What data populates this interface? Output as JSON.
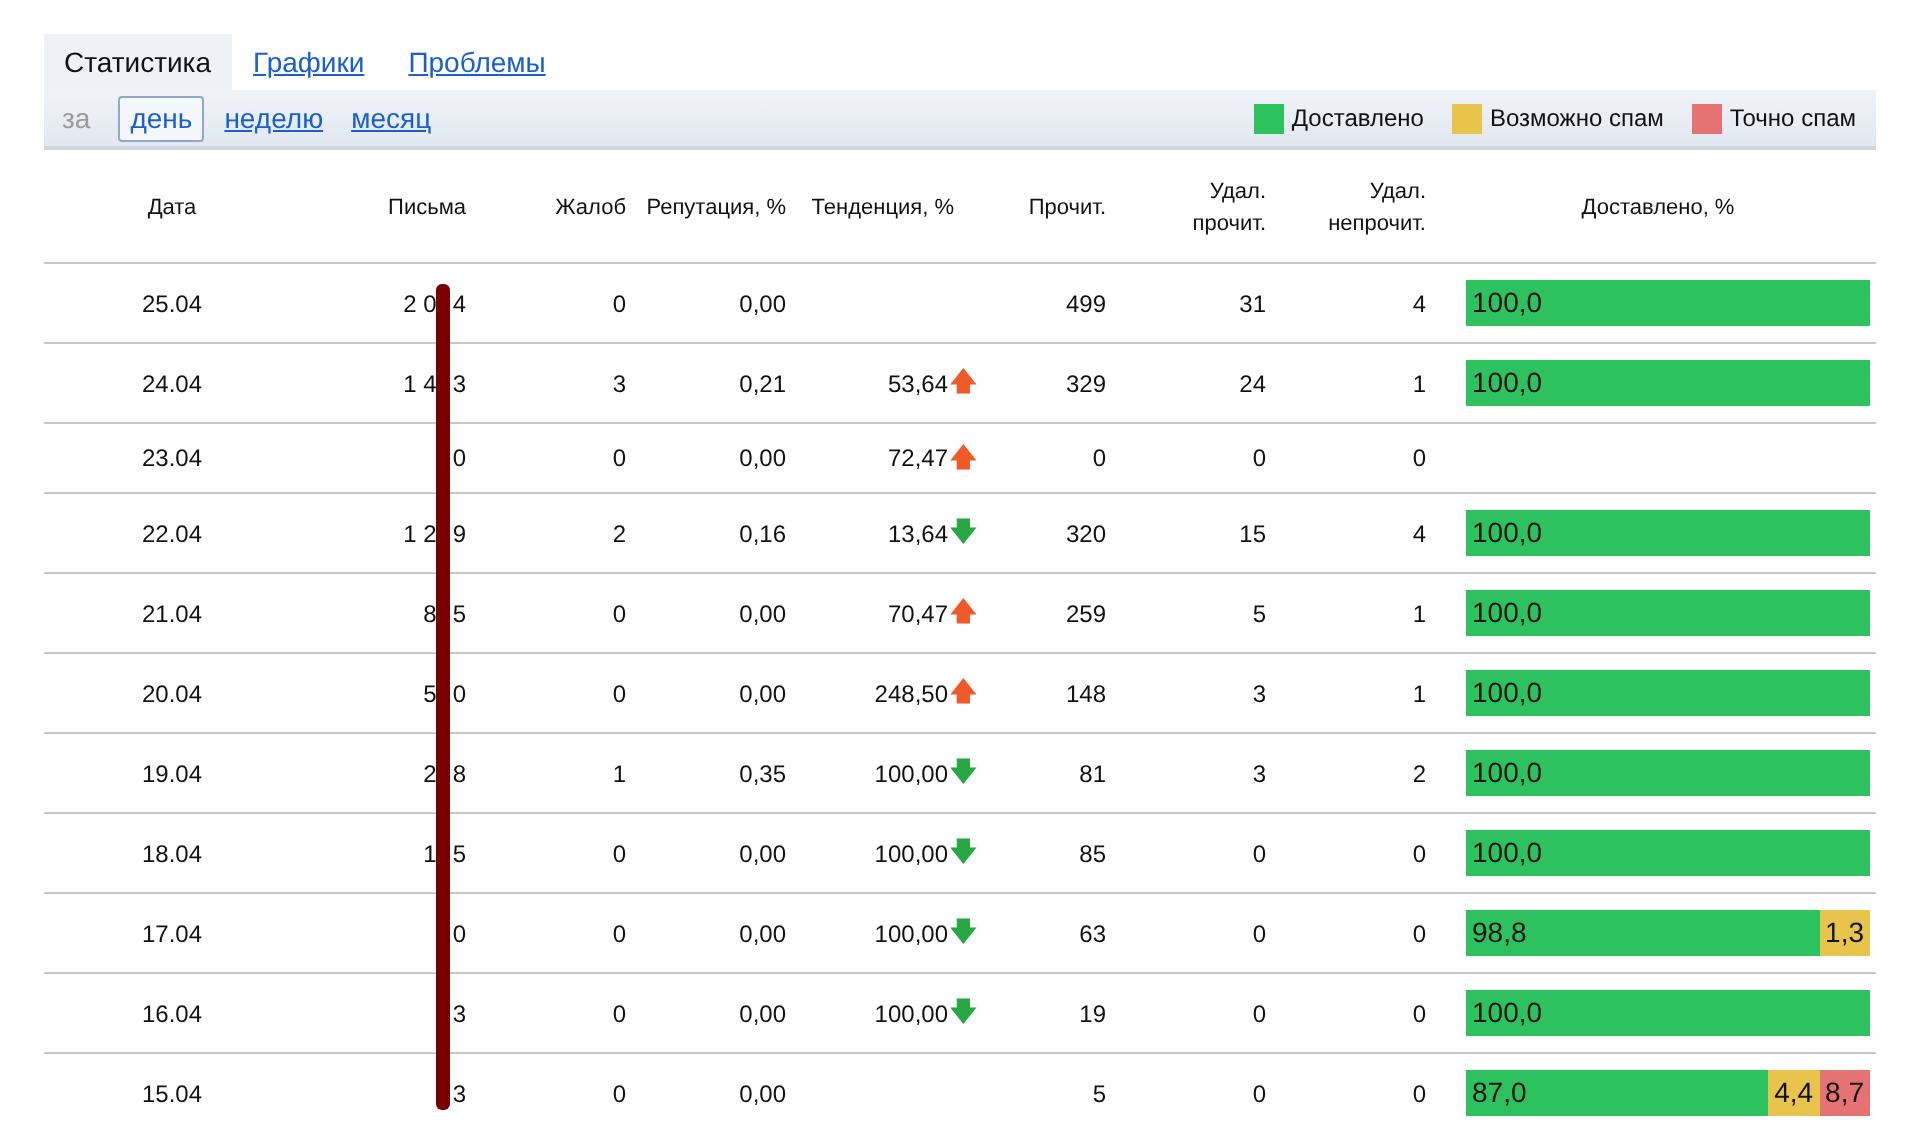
{
  "tabs": [
    {
      "label": "Статистика",
      "selected": true
    },
    {
      "label": "Графики",
      "selected": false
    },
    {
      "label": "Проблемы",
      "selected": false
    }
  ],
  "period": {
    "label": "за",
    "options": [
      {
        "label": "день",
        "selected": true
      },
      {
        "label": "неделю",
        "selected": false
      },
      {
        "label": "месяц",
        "selected": false
      }
    ]
  },
  "legend": [
    {
      "label": "Доставлено",
      "color": "#2dc25e"
    },
    {
      "label": "Возможно спам",
      "color": "#e9c44d"
    },
    {
      "label": "Точно спам",
      "color": "#e57373"
    }
  ],
  "table": {
    "columns": [
      "Дата",
      "Письма",
      "Жалоб",
      "Репутация, %",
      "Тенденция, %",
      "Прочит.",
      "Удал. прочит.",
      "Удал. непрочит.",
      "Доставлено, %"
    ],
    "rows": [
      {
        "date": "25.04",
        "letters_before": "2 0",
        "letters_after": "4",
        "complaints": "0",
        "reputation": "0,00",
        "read": "499",
        "deleted_read": "31",
        "deleted_unread": "4",
        "delivered": [
          {
            "value": "100,0",
            "color": "#2dc25e"
          }
        ]
      },
      {
        "date": "24.04",
        "letters_before": "1 4",
        "letters_after": "3",
        "complaints": "3",
        "reputation": "0,21",
        "trend": {
          "value": "53,64",
          "icon": "🡅",
          "color": "#f05a28"
        },
        "read": "329",
        "deleted_read": "24",
        "deleted_unread": "1",
        "delivered": [
          {
            "value": "100,0",
            "color": "#2dc25e"
          }
        ]
      },
      {
        "date": "23.04",
        "letters_before": "",
        "letters_after": "0",
        "complaints": "0",
        "reputation": "0,00",
        "trend": {
          "value": "72,47",
          "icon": "🡅",
          "color": "#f05a28"
        },
        "read": "0",
        "deleted_read": "0",
        "deleted_unread": "0",
        "delivered": []
      },
      {
        "date": "22.04",
        "letters_before": "1 2",
        "letters_after": "9",
        "complaints": "2",
        "reputation": "0,16",
        "trend": {
          "value": "13,64",
          "icon": "🡇",
          "color": "#27a845"
        },
        "read": "320",
        "deleted_read": "15",
        "deleted_unread": "4",
        "delivered": [
          {
            "value": "100,0",
            "color": "#2dc25e"
          }
        ]
      },
      {
        "date": "21.04",
        "letters_before": "8",
        "letters_after": "5",
        "complaints": "0",
        "reputation": "0,00",
        "trend": {
          "value": "70,47",
          "icon": "🡅",
          "color": "#f05a28"
        },
        "read": "259",
        "deleted_read": "5",
        "deleted_unread": "1",
        "delivered": [
          {
            "value": "100,0",
            "color": "#2dc25e"
          }
        ]
      },
      {
        "date": "20.04",
        "letters_before": "5",
        "letters_after": "0",
        "complaints": "0",
        "reputation": "0,00",
        "trend": {
          "value": "248,50",
          "icon": "🡅",
          "color": "#f05a28"
        },
        "read": "148",
        "deleted_read": "3",
        "deleted_unread": "1",
        "delivered": [
          {
            "value": "100,0",
            "color": "#2dc25e"
          }
        ]
      },
      {
        "date": "19.04",
        "letters_before": "2",
        "letters_after": "8",
        "complaints": "1",
        "reputation": "0,35",
        "trend": {
          "value": "100,00",
          "icon": "🡇",
          "color": "#27a845"
        },
        "read": "81",
        "deleted_read": "3",
        "deleted_unread": "2",
        "delivered": [
          {
            "value": "100,0",
            "color": "#2dc25e"
          }
        ]
      },
      {
        "date": "18.04",
        "letters_before": "1",
        "letters_after": "5",
        "complaints": "0",
        "reputation": "0,00",
        "trend": {
          "value": "100,00",
          "icon": "🡇",
          "color": "#27a845"
        },
        "read": "85",
        "deleted_read": "0",
        "deleted_unread": "0",
        "delivered": [
          {
            "value": "100,0",
            "color": "#2dc25e"
          }
        ]
      },
      {
        "date": "17.04",
        "letters_before": "",
        "letters_after": "0",
        "complaints": "0",
        "reputation": "0,00",
        "trend": {
          "value": "100,00",
          "icon": "🡇",
          "color": "#27a845"
        },
        "read": "63",
        "deleted_read": "0",
        "deleted_unread": "0",
        "delivered": [
          {
            "value": "98,8",
            "color": "#2dc25e"
          },
          {
            "value": "1,3",
            "color": "#e9c44d"
          }
        ]
      },
      {
        "date": "16.04",
        "letters_before": "",
        "letters_after": "3",
        "complaints": "0",
        "reputation": "0,00",
        "trend": {
          "value": "100,00",
          "icon": "🡇",
          "color": "#27a845"
        },
        "read": "19",
        "deleted_read": "0",
        "deleted_unread": "0",
        "delivered": [
          {
            "value": "100,0",
            "color": "#2dc25e"
          }
        ]
      },
      {
        "date": "15.04",
        "letters_before": "",
        "letters_after": "3",
        "complaints": "0",
        "reputation": "0,00",
        "read": "5",
        "deleted_read": "0",
        "deleted_unread": "0",
        "delivered": [
          {
            "value": "87,0",
            "color": "#2dc25e"
          },
          {
            "value": "4,4",
            "color": "#e9c44d"
          },
          {
            "value": "8,7",
            "color": "#e57373"
          }
        ]
      }
    ]
  }
}
